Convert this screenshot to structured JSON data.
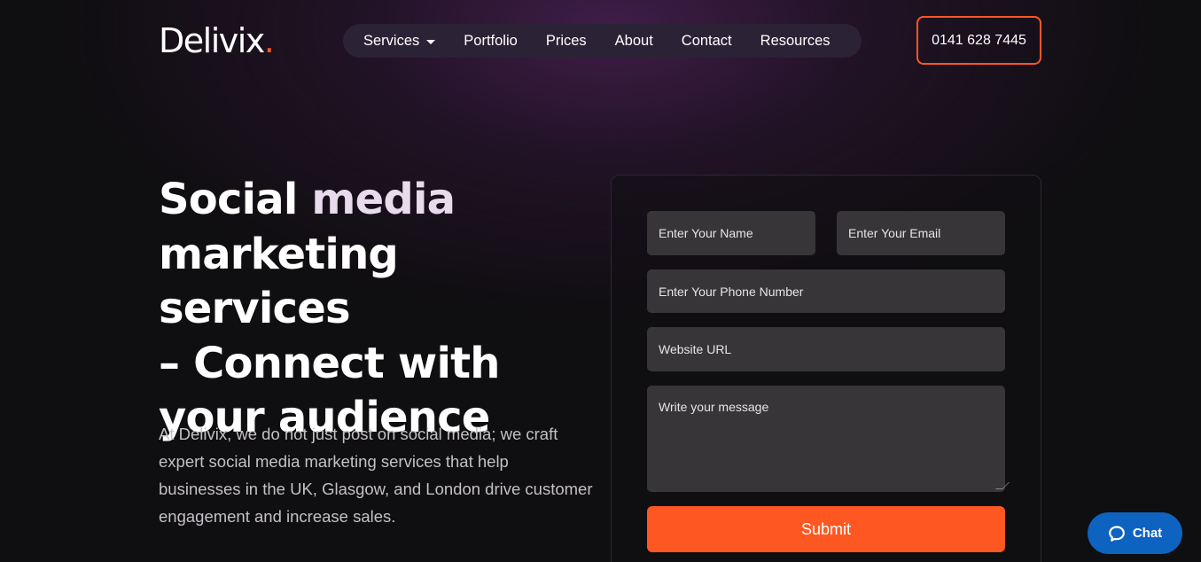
{
  "brand": {
    "name": "Delivix",
    "dot": ".",
    "accent": "#ff5722"
  },
  "nav": {
    "items": [
      {
        "label": "Services",
        "has_dropdown": true
      },
      {
        "label": "Portfolio"
      },
      {
        "label": "Prices"
      },
      {
        "label": "About"
      },
      {
        "label": "Contact"
      },
      {
        "label": "Resources"
      }
    ],
    "dropdown_icon": "chevron-down-icon"
  },
  "phone": {
    "label": "0141 628 7445"
  },
  "hero": {
    "title_line1_a": "Social ",
    "title_line1_b": "media",
    "title_line2": "marketing services",
    "title_line3": "– Connect with",
    "title_line4": "your audience",
    "description": "At Delivix, we do not just post on social media; we craft expert social media marketing services that help businesses in the UK, Glasgow, and London drive customer engagement and increase sales."
  },
  "form": {
    "name_placeholder": "Enter Your Name",
    "email_placeholder": "Enter Your Email",
    "phone_placeholder": "Enter Your Phone Number",
    "website_placeholder": "Website URL",
    "message_placeholder": "Write your message",
    "submit_label": "Submit"
  },
  "chat_widget": {
    "label": "Chat",
    "icon": "chat-bubble-icon",
    "color": "#0e62c0"
  }
}
